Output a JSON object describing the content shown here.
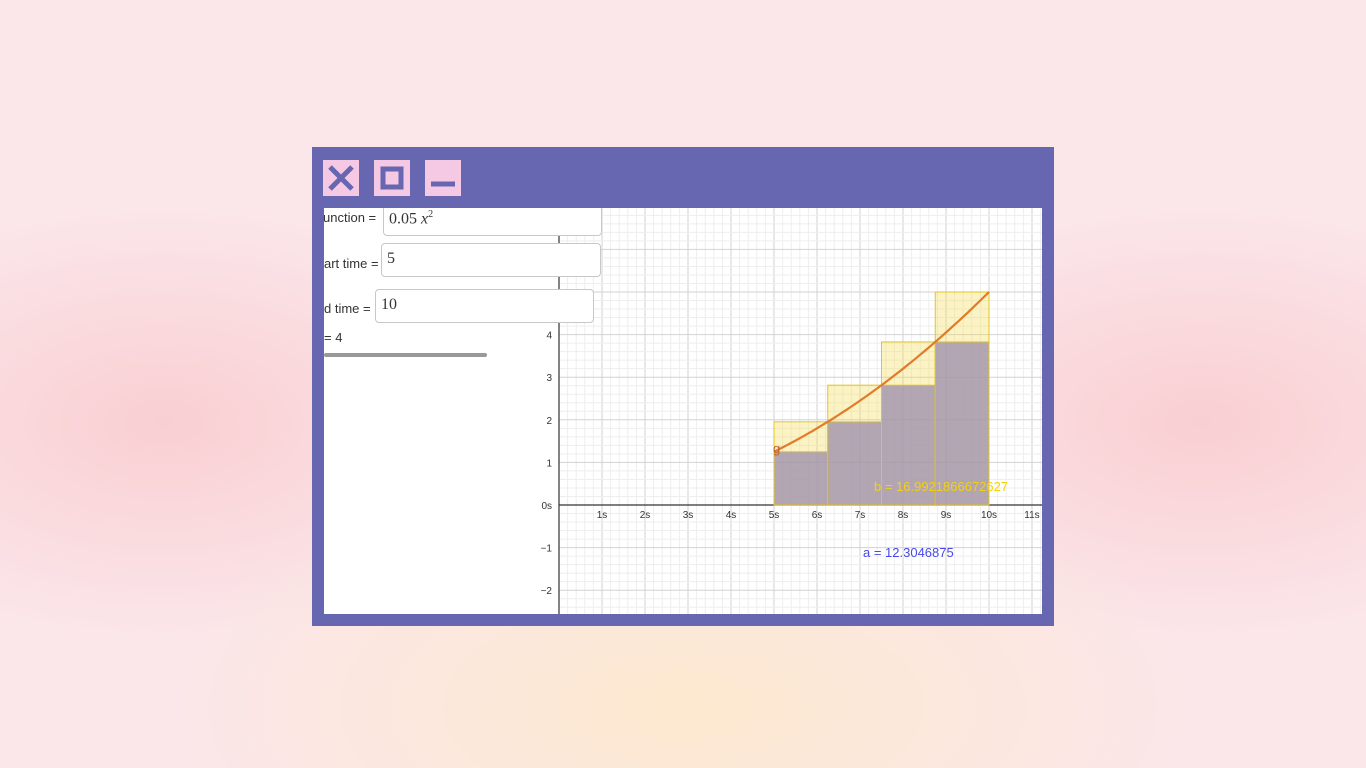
{
  "window": {
    "close_icon": "close-icon",
    "maximize_icon": "maximize-icon",
    "minimize_icon": "minimize-icon",
    "frame_color": "#6667b0",
    "button_color": "#f5c9e4"
  },
  "panel": {
    "function_label": "unction =",
    "function_value_prefix": "0.05 ",
    "function_value_var": "x",
    "function_value_exp": "2",
    "start_label": "art time =",
    "start_value": "5",
    "end_label": "d time =",
    "end_value": "10",
    "slider_label": "= 4"
  },
  "chart_data": {
    "type": "line",
    "function": "0.05 x^2",
    "start": 5,
    "end": 10,
    "rectangles": 4,
    "x_ticks": [
      "1s",
      "2s",
      "3s",
      "4s",
      "5s",
      "6s",
      "7s",
      "8s",
      "9s",
      "10s",
      "11s"
    ],
    "y_ticks": [
      "−2",
      "−1",
      "0s",
      "1",
      "2",
      "3",
      "4"
    ],
    "lower_sum_boxes": [
      {
        "x0": 5,
        "x1": 6.25,
        "height": 1.25
      },
      {
        "x0": 6.25,
        "x1": 7.5,
        "height": 1.953125
      },
      {
        "x0": 7.5,
        "x1": 8.75,
        "height": 2.8125
      },
      {
        "x0": 8.75,
        "x1": 10,
        "height": 3.828125
      }
    ],
    "upper_sum_boxes": [
      {
        "x0": 5,
        "x1": 6.25,
        "height": 1.953125
      },
      {
        "x0": 6.25,
        "x1": 7.5,
        "height": 2.8125
      },
      {
        "x0": 7.5,
        "x1": 8.75,
        "height": 3.828125
      },
      {
        "x0": 8.75,
        "x1": 10,
        "height": 5
      }
    ],
    "curve_label": "g",
    "label_b": "b = 16.9921866672627",
    "label_a": "a = 12.3046875",
    "grid": true,
    "colors": {
      "curve": "#e07b2a",
      "upper": "#f5dd55",
      "lower": "#9b8cae",
      "label_a": "#4848e8",
      "label_b": "#f2d20c"
    }
  }
}
